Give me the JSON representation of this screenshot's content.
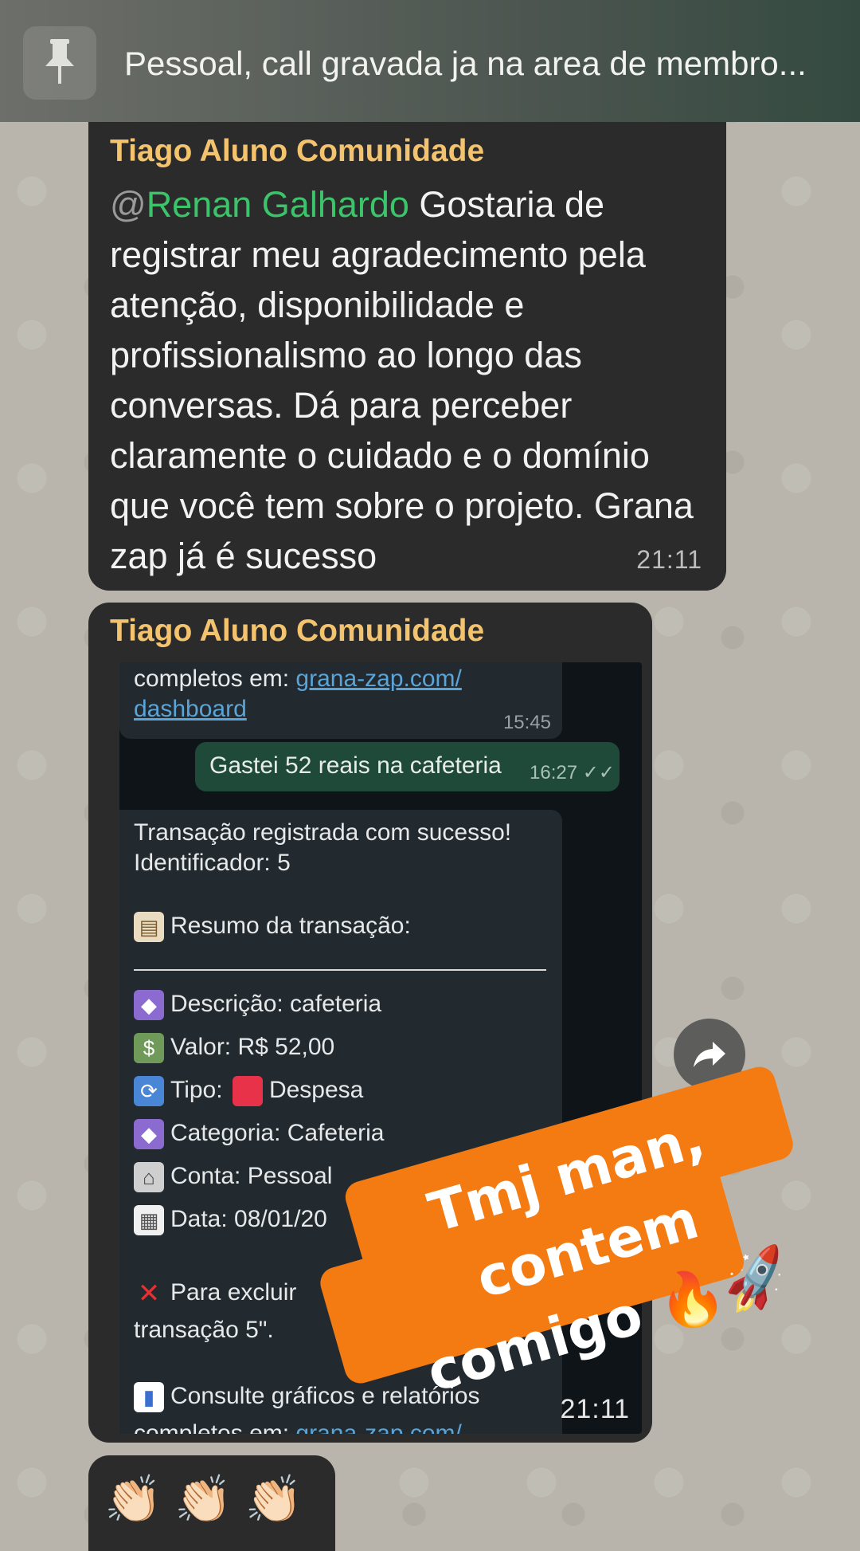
{
  "pinned": {
    "text": "Pessoal, call gravada ja na area de membro..."
  },
  "message1": {
    "sender": "Tiago Aluno Comunidade",
    "mention_at": "@",
    "mention": "Renan Galhardo",
    "text": " Gostaria de registrar meu agradecimento pela atenção, disponibilidade e profissionalismo ao longo das conversas. Dá para perceber claramente o cuidado e o domínio que você tem sobre o projeto. Grana zap já é sucesso",
    "time": "21:11"
  },
  "message2": {
    "sender": "Tiago Aluno Comunidade",
    "time": "21:11",
    "screenshot": {
      "top_bubble": {
        "text_before": "completos em: ",
        "link_line1": "grana-zap.com/",
        "link_line2": "dashboard",
        "time": "15:45"
      },
      "outgoing": {
        "text": "Gastei 52 reais na cafeteria",
        "time": "16:27",
        "status_icon": "double-check-icon"
      },
      "reply": {
        "line1": "Transação registrada com sucesso!",
        "line2": "Identificador: 5",
        "summary": "Resumo da transação:",
        "descricao": "Descrição: cafeteria",
        "valor": "Valor: R$ 52,00",
        "tipo_label": "Tipo:",
        "tipo_value": "Despesa",
        "categoria": "Categoria: Cafeteria",
        "conta": "Conta: Pessoal",
        "data": "Data: 08/01/20",
        "excluir": "Para excluir",
        "excluir2": "transação 5\".",
        "consulte": "Consulte gráficos e relatórios",
        "completos": "completos em: ",
        "completos_link": "grana-zap.com/"
      }
    }
  },
  "message3": {
    "claps": "👏🏻 👏🏻 👏🏻"
  },
  "sticker": {
    "line1": "Tmj man, contem",
    "line2": "comigo 🔥🚀"
  },
  "colors": {
    "bubble": "#2b2b2b",
    "sender": "#f3c36e",
    "mention": "#3cc46a",
    "sticker": "#f47a12"
  }
}
